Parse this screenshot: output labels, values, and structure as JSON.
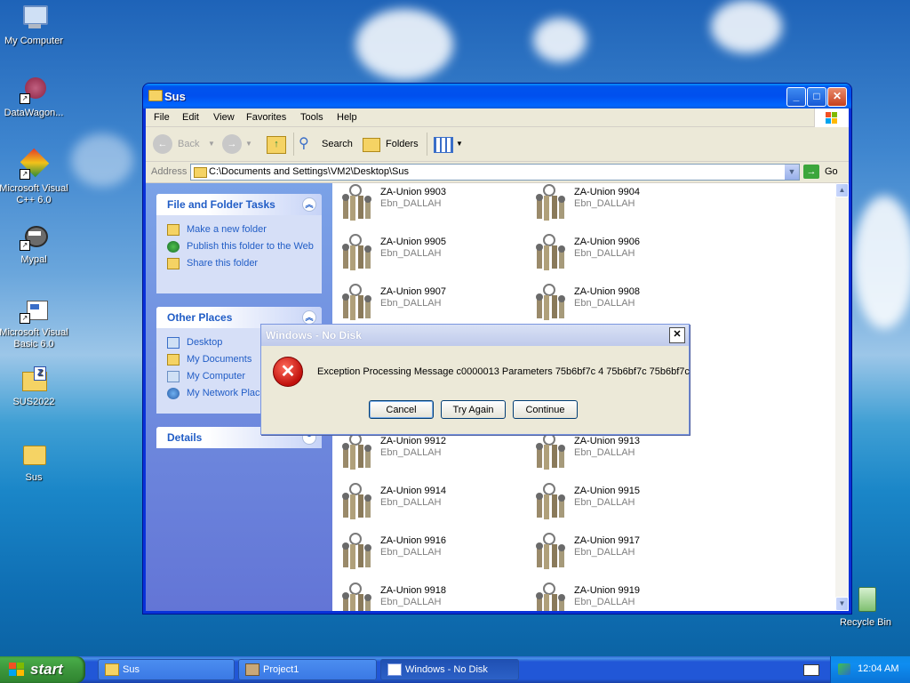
{
  "desktop": {
    "icons": [
      {
        "label": "My Computer"
      },
      {
        "label": "DataWagon..."
      },
      {
        "label": "Microsoft Visual C++ 6.0"
      },
      {
        "label": "Mypal"
      },
      {
        "label": "Microsoft Visual Basic 6.0"
      },
      {
        "label": "SUS2022"
      },
      {
        "label": "Sus"
      },
      {
        "label": "Recycle Bin"
      }
    ]
  },
  "window": {
    "title": "Sus",
    "menu": [
      "File",
      "Edit",
      "View",
      "Favorites",
      "Tools",
      "Help"
    ],
    "toolbar": {
      "back": "Back",
      "search": "Search",
      "folders": "Folders"
    },
    "address": {
      "label": "Address",
      "value": "C:\\Documents and Settings\\VM2\\Desktop\\Sus",
      "go": "Go"
    }
  },
  "taskpane": {
    "file_tasks": {
      "title": "File and Folder Tasks",
      "items": [
        "Make a new folder",
        "Publish this folder to the Web",
        "Share this folder"
      ]
    },
    "other_places": {
      "title": "Other Places",
      "items": [
        "Desktop",
        "My Documents",
        "My Computer",
        "My Network Places"
      ]
    },
    "details": {
      "title": "Details"
    }
  },
  "files": [
    {
      "name": "ZA-Union 9903",
      "sub": "Ebn_DALLAH"
    },
    {
      "name": "ZA-Union 9904",
      "sub": "Ebn_DALLAH"
    },
    {
      "name": "ZA-Union 9905",
      "sub": "Ebn_DALLAH"
    },
    {
      "name": "ZA-Union 9906",
      "sub": "Ebn_DALLAH"
    },
    {
      "name": "ZA-Union 9907",
      "sub": "Ebn_DALLAH"
    },
    {
      "name": "ZA-Union 9908",
      "sub": "Ebn_DALLAH"
    },
    {
      "name": "ZA-Union 9912",
      "sub": "Ebn_DALLAH"
    },
    {
      "name": "ZA-Union 9913",
      "sub": "Ebn_DALLAH"
    },
    {
      "name": "ZA-Union 9914",
      "sub": "Ebn_DALLAH"
    },
    {
      "name": "ZA-Union 9915",
      "sub": "Ebn_DALLAH"
    },
    {
      "name": "ZA-Union 9916",
      "sub": "Ebn_DALLAH"
    },
    {
      "name": "ZA-Union 9917",
      "sub": "Ebn_DALLAH"
    },
    {
      "name": "ZA-Union 9918",
      "sub": "Ebn_DALLAH"
    },
    {
      "name": "ZA-Union 9919",
      "sub": "Ebn_DALLAH"
    }
  ],
  "dialog": {
    "title": "Windows - No Disk",
    "message": "Exception Processing Message c0000013 Parameters 75b6bf7c 4 75b6bf7c 75b6bf7c",
    "buttons": {
      "cancel": "Cancel",
      "try_again": "Try Again",
      "continue": "Continue"
    }
  },
  "taskbar": {
    "start": "start",
    "tasks": [
      "Sus",
      "Project1",
      "Windows - No Disk"
    ],
    "clock": "12:04 AM"
  },
  "colors": {
    "xp_blue": "#0831d9",
    "taskbar_blue": "#2157d7",
    "start_green": "#3c963c",
    "link_blue": "#215dc6"
  }
}
